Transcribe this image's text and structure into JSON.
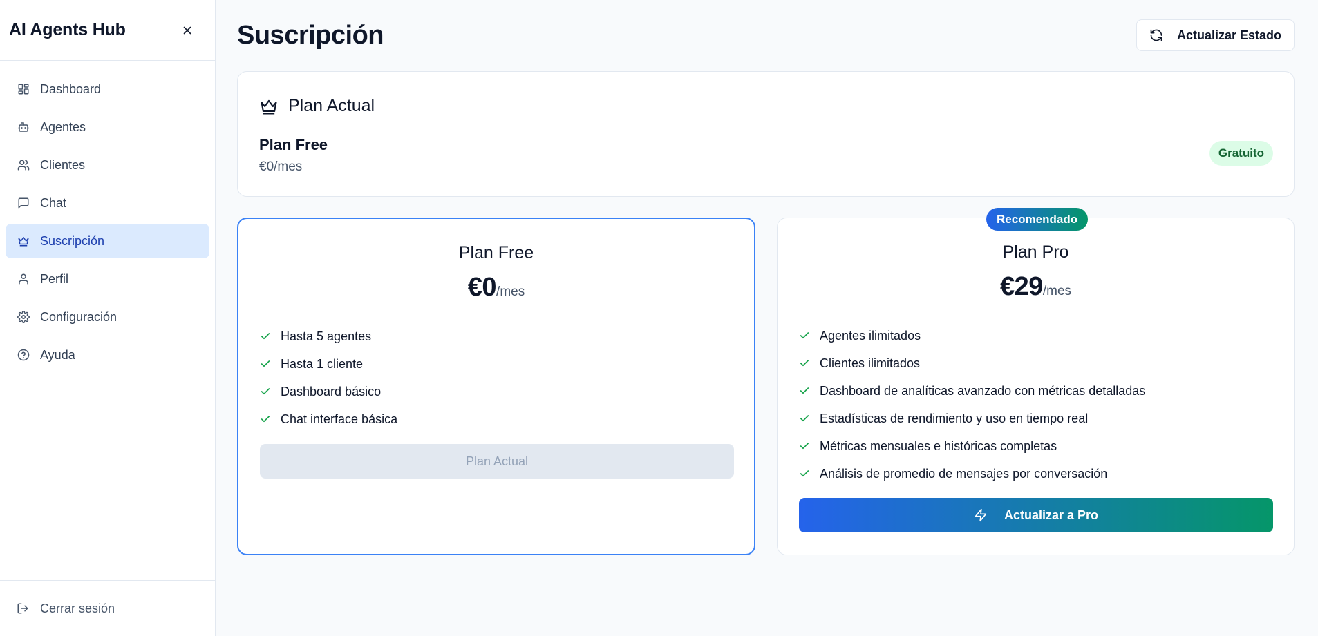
{
  "sidebar": {
    "title": "AI Agents Hub",
    "items": [
      {
        "label": "Dashboard",
        "icon": "dashboard-icon",
        "active": false
      },
      {
        "label": "Agentes",
        "icon": "bot-icon",
        "active": false
      },
      {
        "label": "Clientes",
        "icon": "users-icon",
        "active": false
      },
      {
        "label": "Chat",
        "icon": "chat-icon",
        "active": false
      },
      {
        "label": "Suscripción",
        "icon": "crown-icon",
        "active": true
      },
      {
        "label": "Perfil",
        "icon": "user-icon",
        "active": false
      },
      {
        "label": "Configuración",
        "icon": "gear-icon",
        "active": false
      },
      {
        "label": "Ayuda",
        "icon": "help-icon",
        "active": false
      }
    ],
    "logout_label": "Cerrar sesión"
  },
  "header": {
    "title": "Suscripción",
    "refresh_label": "Actualizar Estado"
  },
  "current_plan": {
    "heading": "Plan Actual",
    "plan_name": "Plan Free",
    "price": "€0/mes",
    "badge": "Gratuito"
  },
  "plans": {
    "free": {
      "name": "Plan Free",
      "price": "€0",
      "period": "/mes",
      "features": [
        "Hasta 5 agentes",
        "Hasta 1 cliente",
        "Dashboard básico",
        "Chat interface básica"
      ],
      "button_label": "Plan Actual"
    },
    "pro": {
      "badge": "Recomendado",
      "name": "Plan Pro",
      "price": "€29",
      "period": "/mes",
      "features": [
        "Agentes ilimitados",
        "Clientes ilimitados",
        "Dashboard de analíticas avanzado con métricas detalladas",
        "Estadísticas de rendimiento y uso en tiempo real",
        "Métricas mensuales e históricas completas",
        "Análisis de promedio de mensajes por conversación"
      ],
      "button_label": "Actualizar a Pro"
    }
  },
  "colors": {
    "primary": "#2563eb",
    "accent_green": "#059669",
    "active_nav_bg": "#dbeafe",
    "check_green": "#16a34a"
  }
}
